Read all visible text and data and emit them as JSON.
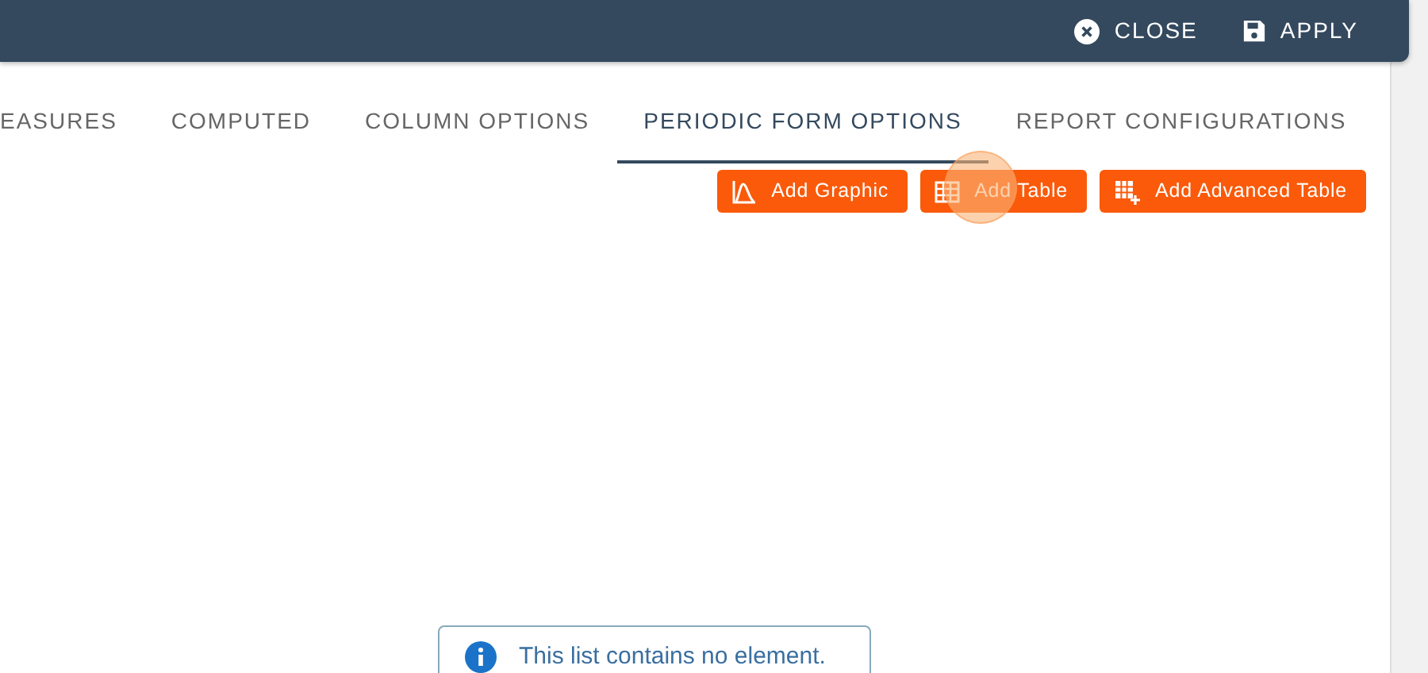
{
  "header": {
    "actions": [
      {
        "kind": "close",
        "label": "CLOSE"
      },
      {
        "kind": "save",
        "label": "APPLY"
      }
    ]
  },
  "tabs": [
    {
      "label": "EASURES",
      "selected": false
    },
    {
      "label": "COMPUTED",
      "selected": false
    },
    {
      "label": "COLUMN OPTIONS",
      "selected": false
    },
    {
      "label": "PERIODIC FORM OPTIONS",
      "selected": true
    },
    {
      "label": "REPORT CONFIGURATIONS",
      "selected": false
    }
  ],
  "buttons": [
    {
      "kind": "graphic",
      "label": "Add Graphic"
    },
    {
      "kind": "table",
      "label": "Add Table"
    },
    {
      "kind": "advanced",
      "label": "Add Advanced Table"
    }
  ],
  "empty_message": "This list contains no element."
}
